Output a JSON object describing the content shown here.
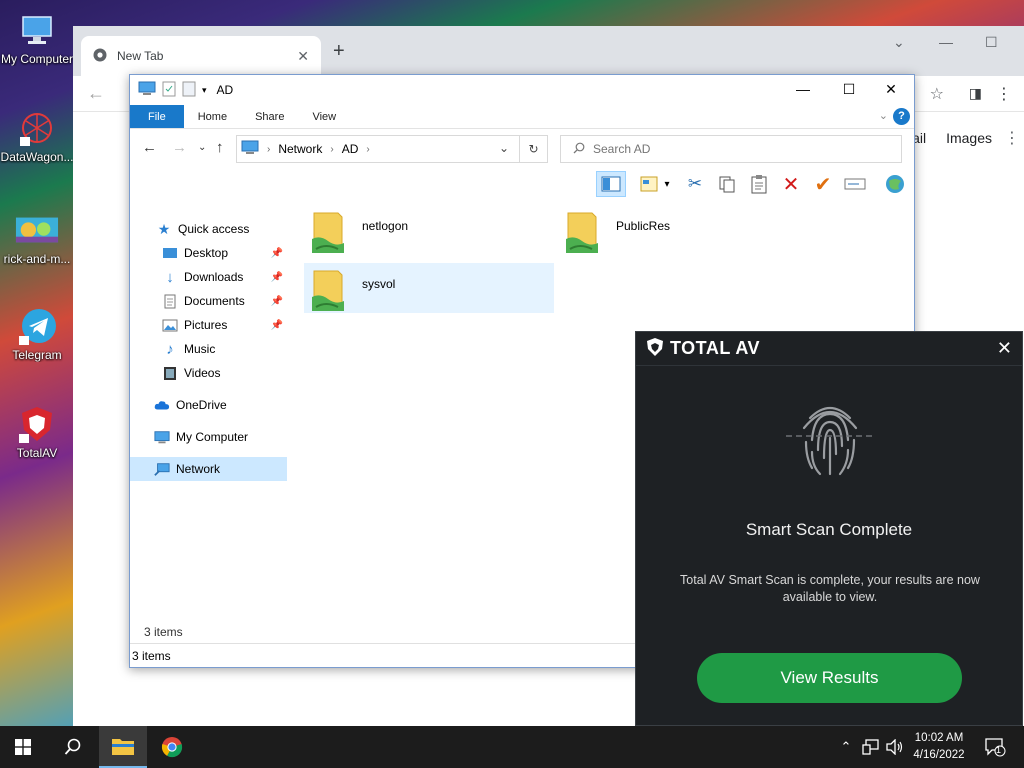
{
  "desktop": {
    "icons": [
      {
        "label": "My Computer"
      },
      {
        "label": "DataWagon..."
      },
      {
        "label": "rick-and-m..."
      },
      {
        "label": "Telegram"
      },
      {
        "label": "TotalAV"
      }
    ]
  },
  "chrome": {
    "tab_title": "New Tab",
    "links": {
      "gmail": "mail",
      "images": "Images"
    }
  },
  "explorer": {
    "title": "AD",
    "ribbon": {
      "file": "File",
      "home": "Home",
      "share": "Share",
      "view": "View",
      "help": "?"
    },
    "address": {
      "parts": [
        "Network",
        "AD"
      ]
    },
    "search_placeholder": "Search AD",
    "nav": {
      "quick_access": "Quick access",
      "desktop": "Desktop",
      "downloads": "Downloads",
      "documents": "Documents",
      "pictures": "Pictures",
      "music": "Music",
      "videos": "Videos",
      "onedrive": "OneDrive",
      "my_computer": "My Computer",
      "network": "Network"
    },
    "files": [
      {
        "name": "netlogon"
      },
      {
        "name": "PublicRes"
      },
      {
        "name": "sysvol"
      }
    ],
    "item_count": "3 items",
    "status": "3 items"
  },
  "totalav": {
    "brand": "TOTAL AV",
    "title": "Smart Scan Complete",
    "message": "Total AV Smart Scan is complete, your results are now available to view.",
    "button": "View Results"
  },
  "taskbar": {
    "time": "10:02 AM",
    "date": "4/16/2022",
    "notifications": "1"
  },
  "colors": {
    "file_tab": "#1979ca",
    "tav_bg": "#1e2124",
    "tav_button": "#1f9a45",
    "selection": "#cce8ff"
  }
}
